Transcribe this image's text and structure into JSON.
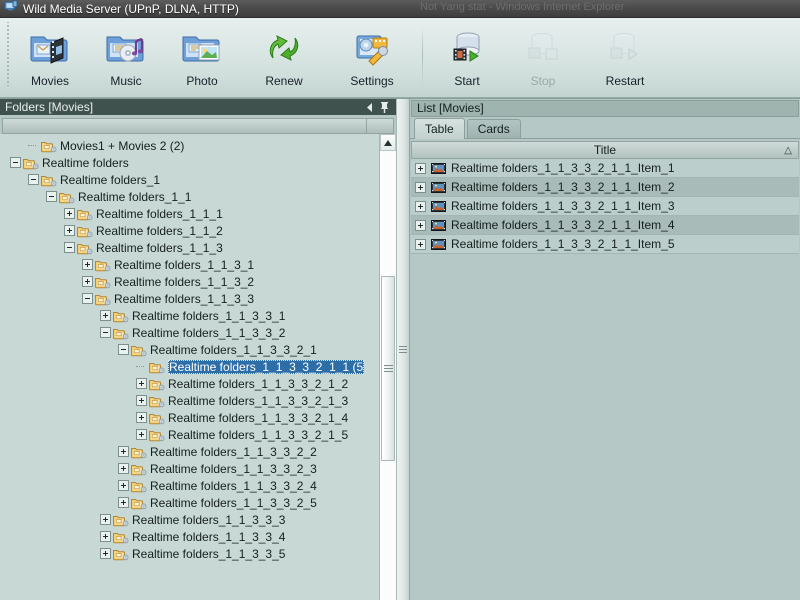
{
  "window": {
    "title": "Wild Media Server (UPnP, DLNA, HTTP)",
    "icon": "server-monitor-icon",
    "ghost_title": "Not Yang stat - Windows Internet Explorer"
  },
  "toolbar": {
    "buttons": [
      {
        "label": "Movies",
        "icon": "movies-folder-icon",
        "enabled": true
      },
      {
        "label": "Music",
        "icon": "music-folder-icon",
        "enabled": true
      },
      {
        "label": "Photo",
        "icon": "photo-folder-icon",
        "enabled": true
      },
      {
        "label": "Renew",
        "icon": "renew-arrows-icon",
        "enabled": true
      },
      {
        "label": "Settings",
        "icon": "settings-wrench-icon",
        "enabled": true
      },
      {
        "label": "Start",
        "icon": "server-start-icon",
        "enabled": true
      },
      {
        "label": "Stop",
        "icon": "server-stop-icon",
        "enabled": false
      },
      {
        "label": "Restart",
        "icon": "server-restart-icon",
        "enabled": false
      }
    ]
  },
  "left_panel": {
    "header": "Folders [Movies]",
    "collapse_icon": "collapse-left-arrow-icon",
    "pin_icon": "pin-icon",
    "tree": [
      {
        "label": "Movies1 + Movies 2 (2)",
        "depth": 1,
        "state": "leaf",
        "selected": false
      },
      {
        "label": "Realtime folders",
        "depth": 0,
        "state": "collapsed",
        "selected": false
      },
      {
        "label": "Realtime folders_1",
        "depth": 1,
        "state": "collapsed",
        "selected": false
      },
      {
        "label": "Realtime folders_1_1",
        "depth": 2,
        "state": "collapsed",
        "selected": false
      },
      {
        "label": "Realtime folders_1_1_1",
        "depth": 3,
        "state": "expanded",
        "selected": false
      },
      {
        "label": "Realtime folders_1_1_2",
        "depth": 3,
        "state": "expanded",
        "selected": false
      },
      {
        "label": "Realtime folders_1_1_3",
        "depth": 3,
        "state": "collapsed",
        "selected": false
      },
      {
        "label": "Realtime folders_1_1_3_1",
        "depth": 4,
        "state": "expanded",
        "selected": false
      },
      {
        "label": "Realtime folders_1_1_3_2",
        "depth": 4,
        "state": "expanded",
        "selected": false
      },
      {
        "label": "Realtime folders_1_1_3_3",
        "depth": 4,
        "state": "collapsed",
        "selected": false
      },
      {
        "label": "Realtime folders_1_1_3_3_1",
        "depth": 5,
        "state": "expanded",
        "selected": false
      },
      {
        "label": "Realtime folders_1_1_3_3_2",
        "depth": 5,
        "state": "collapsed",
        "selected": false
      },
      {
        "label": "Realtime folders_1_1_3_3_2_1",
        "depth": 6,
        "state": "collapsed",
        "selected": false
      },
      {
        "label": "Realtime folders_1_1_3_3_2_1_1 (5",
        "depth": 7,
        "state": "leaf",
        "selected": true
      },
      {
        "label": "Realtime folders_1_1_3_3_2_1_2",
        "depth": 7,
        "state": "expanded",
        "selected": false
      },
      {
        "label": "Realtime folders_1_1_3_3_2_1_3",
        "depth": 7,
        "state": "expanded",
        "selected": false
      },
      {
        "label": "Realtime folders_1_1_3_3_2_1_4",
        "depth": 7,
        "state": "expanded",
        "selected": false
      },
      {
        "label": "Realtime folders_1_1_3_3_2_1_5",
        "depth": 7,
        "state": "expanded",
        "selected": false
      },
      {
        "label": "Realtime folders_1_1_3_3_2_2",
        "depth": 6,
        "state": "expanded",
        "selected": false
      },
      {
        "label": "Realtime folders_1_1_3_3_2_3",
        "depth": 6,
        "state": "expanded",
        "selected": false
      },
      {
        "label": "Realtime folders_1_1_3_3_2_4",
        "depth": 6,
        "state": "expanded",
        "selected": false
      },
      {
        "label": "Realtime folders_1_1_3_3_2_5",
        "depth": 6,
        "state": "expanded",
        "selected": false
      },
      {
        "label": "Realtime folders_1_1_3_3_3",
        "depth": 5,
        "state": "expanded",
        "selected": false
      },
      {
        "label": "Realtime folders_1_1_3_3_4",
        "depth": 5,
        "state": "expanded",
        "selected": false
      },
      {
        "label": "Realtime folders_1_1_3_3_5",
        "depth": 5,
        "state": "expanded",
        "selected": false
      }
    ]
  },
  "right_panel": {
    "header": "List [Movies]",
    "tabs": [
      {
        "label": "Table",
        "active": true
      },
      {
        "label": "Cards",
        "active": false
      }
    ],
    "column_header": {
      "title": "Title",
      "sort_indicator": "△"
    },
    "rows": [
      {
        "label": "Realtime folders_1_1_3_3_2_1_1_Item_1",
        "icon": "movie-item-icon"
      },
      {
        "label": "Realtime folders_1_1_3_3_2_1_1_Item_2",
        "icon": "movie-item-icon"
      },
      {
        "label": "Realtime folders_1_1_3_3_2_1_1_Item_3",
        "icon": "movie-item-icon"
      },
      {
        "label": "Realtime folders_1_1_3_3_2_1_1_Item_4",
        "icon": "movie-item-icon"
      },
      {
        "label": "Realtime folders_1_1_3_3_2_1_1_Item_5",
        "icon": "movie-item-icon"
      }
    ]
  },
  "colors": {
    "titlebar": "#4a4a4a",
    "toolbar": "#dbe7e5",
    "panel_header": "#40524d",
    "tree_background": "#c8d8d4",
    "selection": "#2d6ea8",
    "row_alt": "#a9bbb8",
    "folder_yellow": "#f2c95e"
  }
}
